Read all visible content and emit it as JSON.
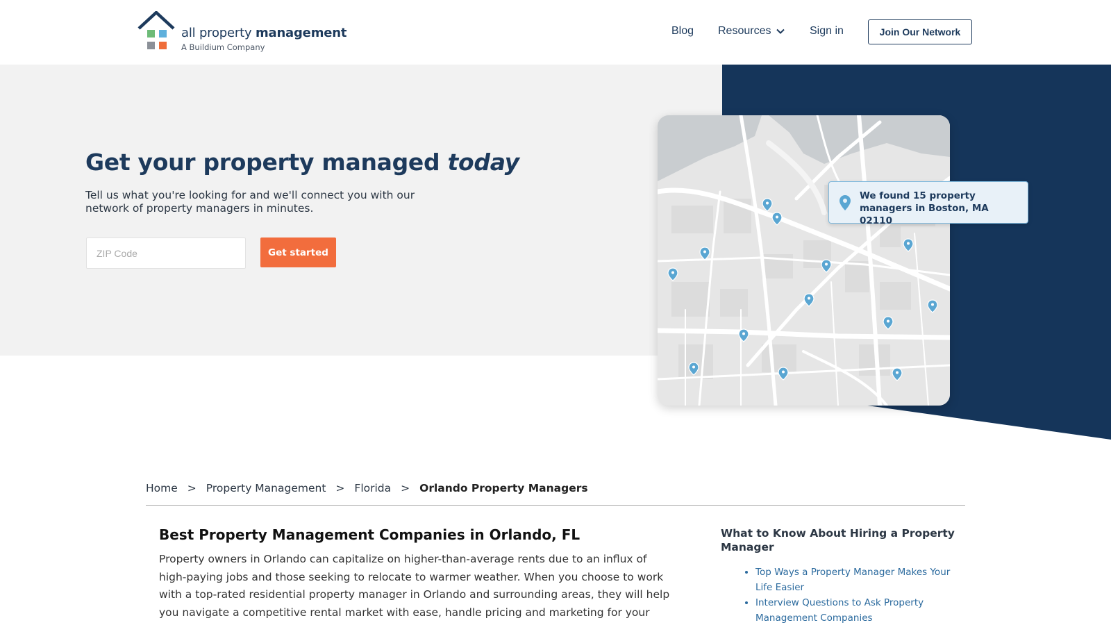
{
  "header": {
    "logo": {
      "name_light": "all property ",
      "name_bold": "management",
      "tagline": "A Buildium Company"
    },
    "nav": {
      "blog": "Blog",
      "resources": "Resources",
      "sign_in": "Sign in",
      "join_button": "Join Our Network"
    }
  },
  "hero": {
    "title_plain": "Get your property managed ",
    "title_emphasis": "today",
    "subtitle": "Tell us what you're looking for and we'll connect you with our network of property managers in minutes.",
    "zip_placeholder": "ZIP Code",
    "zip_value": "",
    "cta_button": "Get started",
    "map_callout": "We found 15 property managers in Boston, MA 02110"
  },
  "colors": {
    "navy": "#15355a",
    "orange": "#f26d3d",
    "pin_blue": "#5aa6d2",
    "logo_green": "#6dbb78",
    "logo_blue": "#5fb0dc",
    "logo_gray": "#8b9098",
    "logo_orange": "#ef6d3a"
  },
  "breadcrumb": {
    "items": [
      "Home",
      "Property Management",
      "Florida"
    ],
    "separator": ">",
    "current": "Orlando Property Managers"
  },
  "main": {
    "title": "Best Property Management Companies in Orlando, FL",
    "paragraph": "Property owners in Orlando can capitalize on higher-than-average rents due to an influx of high-paying jobs and those seeking to relocate to warmer weather. When you choose to work with a top-rated residential property manager in Orlando and surrounding areas, they will help you navigate a competitive rental market with ease, handle pricing and marketing for your rental, take"
  },
  "sidebar": {
    "title": "What to Know About Hiring a Property Manager",
    "links": [
      "Top Ways a Property Manager Makes Your Life Easier",
      "Interview Questions to Ask Property Management Companies"
    ]
  },
  "icons": {
    "logo": "house-logo-icon",
    "resources_chevron": "chevron-down-icon",
    "map_pin": "map-pin-icon"
  }
}
